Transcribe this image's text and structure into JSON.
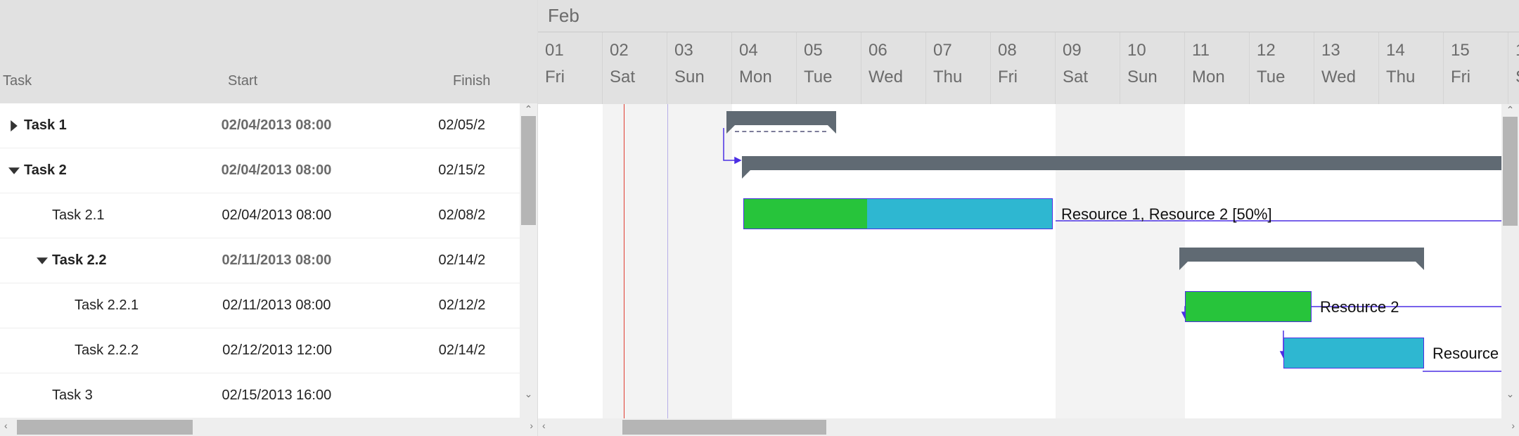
{
  "header": {
    "columns": {
      "task": "Task",
      "start": "Start",
      "finish": "Finish"
    },
    "month": "Feb",
    "days": [
      {
        "num": "01",
        "dow": "Fri",
        "weekend": false
      },
      {
        "num": "02",
        "dow": "Sat",
        "weekend": true
      },
      {
        "num": "03",
        "dow": "Sun",
        "weekend": true
      },
      {
        "num": "04",
        "dow": "Mon",
        "weekend": false
      },
      {
        "num": "05",
        "dow": "Tue",
        "weekend": false
      },
      {
        "num": "06",
        "dow": "Wed",
        "weekend": false
      },
      {
        "num": "07",
        "dow": "Thu",
        "weekend": false
      },
      {
        "num": "08",
        "dow": "Fri",
        "weekend": false
      },
      {
        "num": "09",
        "dow": "Sat",
        "weekend": true
      },
      {
        "num": "10",
        "dow": "Sun",
        "weekend": true
      },
      {
        "num": "11",
        "dow": "Mon",
        "weekend": false
      },
      {
        "num": "12",
        "dow": "Tue",
        "weekend": false
      },
      {
        "num": "13",
        "dow": "Wed",
        "weekend": false
      },
      {
        "num": "14",
        "dow": "Thu",
        "weekend": false
      },
      {
        "num": "15",
        "dow": "Fri",
        "weekend": false
      },
      {
        "num": "1",
        "dow": "S",
        "weekend": true
      }
    ]
  },
  "rows": [
    {
      "name": "Task 1",
      "start": "02/04/2013 08:00",
      "finish": "02/05/2",
      "parent": true,
      "caret": "right",
      "indent": 0
    },
    {
      "name": "Task 2",
      "start": "02/04/2013 08:00",
      "finish": "02/15/2",
      "parent": true,
      "caret": "down",
      "indent": 0
    },
    {
      "name": "Task 2.1",
      "start": "02/04/2013 08:00",
      "finish": "02/08/2",
      "parent": false,
      "caret": "",
      "indent": 1
    },
    {
      "name": "Task 2.2",
      "start": "02/11/2013 08:00",
      "finish": "02/14/2",
      "parent": true,
      "caret": "down",
      "indent": 1
    },
    {
      "name": "Task 2.2.1",
      "start": "02/11/2013 08:00",
      "finish": "02/12/2",
      "parent": false,
      "caret": "",
      "indent": 2
    },
    {
      "name": "Task 2.2.2",
      "start": "02/12/2013 12:00",
      "finish": "02/14/2",
      "parent": false,
      "caret": "",
      "indent": 2
    },
    {
      "name": "Task 3",
      "start": "02/15/2013 16:00",
      "finish": "",
      "parent": false,
      "caret": "",
      "indent": 1
    }
  ],
  "labels": {
    "res_21": "Resource 1, Resource 2 [50%]",
    "res_221": "Resource 2",
    "res_222": "Resource"
  },
  "chart_data": {
    "type": "gantt",
    "unit": "days",
    "origin": "2013-02-01",
    "tasks": [
      {
        "id": "t1",
        "name": "Task 1",
        "type": "summary",
        "start": "2013-02-04T08:00",
        "end": "2013-02-05T16:00"
      },
      {
        "id": "t2",
        "name": "Task 2",
        "type": "summary",
        "start": "2013-02-04T08:00",
        "end": "2013-02-15T16:00"
      },
      {
        "id": "t21",
        "name": "Task 2.1",
        "type": "task",
        "start": "2013-02-04T08:00",
        "end": "2013-02-08T16:00",
        "progress": 0.4,
        "resources": [
          "Resource 1",
          "Resource 2 [50%]"
        ]
      },
      {
        "id": "t22",
        "name": "Task 2.2",
        "type": "summary",
        "start": "2013-02-11T08:00",
        "end": "2013-02-14T16:00"
      },
      {
        "id": "t221",
        "name": "Task 2.2.1",
        "type": "task",
        "start": "2013-02-11T08:00",
        "end": "2013-02-12T16:00",
        "progress": 1.0,
        "resources": [
          "Resource 2"
        ]
      },
      {
        "id": "t222",
        "name": "Task 2.2.2",
        "type": "task",
        "start": "2013-02-12T12:00",
        "end": "2013-02-14T16:00",
        "progress": 0.0,
        "resources": [
          "Resource"
        ]
      },
      {
        "id": "t3",
        "name": "Task 3",
        "type": "milestone",
        "at": "2013-02-15T16:00"
      }
    ],
    "dependencies": [
      {
        "from": "t1",
        "to": "t2",
        "type": "FS"
      },
      {
        "from": "t21",
        "to": "t221",
        "type": "FS"
      },
      {
        "from": "t221",
        "to": "t222",
        "type": "FS"
      },
      {
        "from": "t222",
        "to": "t3",
        "type": "FS"
      }
    ]
  }
}
